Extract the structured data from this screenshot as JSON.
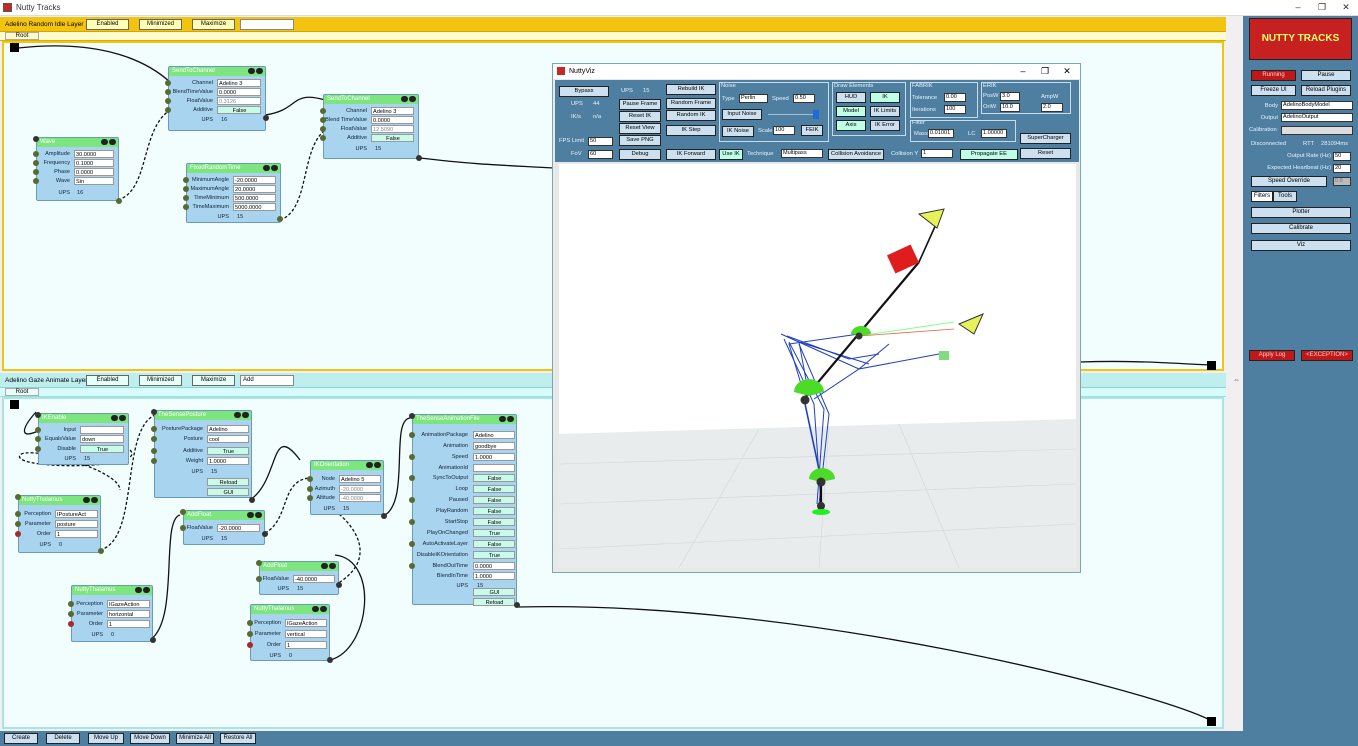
{
  "window": {
    "title": "Nutty Tracks",
    "min": "–",
    "max": "❐",
    "close": "✕"
  },
  "layer1": {
    "name": "Adelino Random Idle Layer",
    "enabled": "Enabled",
    "minimized": "Minimized",
    "maximize": "Maximize",
    "mode": "",
    "root": "Root"
  },
  "layer2": {
    "name": "Adelino Gaze Animate Layer",
    "enabled": "Enabled",
    "minimized": "Minimized",
    "maximize": "Maximize",
    "mode": "Add",
    "root": "Root"
  },
  "nodes": {
    "send1": {
      "title": "SendToChannel",
      "rows": [
        [
          "Channel",
          "Adelino 3"
        ],
        [
          "BlendTimeValue",
          "0.0000"
        ],
        [
          "FloatValue",
          "0.3126"
        ],
        [
          "Additive",
          "False"
        ],
        [
          "UPS",
          "16"
        ]
      ]
    },
    "wave": {
      "title": "Wave",
      "rows": [
        [
          "Amplitude",
          "30.0000"
        ],
        [
          "Frequency",
          "0.1000"
        ],
        [
          "Phase",
          "0.0000"
        ],
        [
          "Wave",
          "Sin"
        ],
        [
          "UPS",
          "16"
        ]
      ]
    },
    "rand": {
      "title": "FixedRandomTime",
      "rows": [
        [
          "MinimumAngle",
          "-20.0000"
        ],
        [
          "MaximumAngle",
          "20.0000"
        ],
        [
          "TimeMinimum",
          "500.0000"
        ],
        [
          "TimeMaximum",
          "5000.0000"
        ],
        [
          "UPS",
          "15"
        ]
      ]
    },
    "send2": {
      "title": "SendToChannel",
      "rows": [
        [
          "Channel",
          "Adelino 3"
        ],
        [
          "Blend TimeValue",
          "0.0000"
        ],
        [
          "FloatValue",
          "12.5090"
        ],
        [
          "Additive",
          "False"
        ],
        [
          "UPS",
          "15"
        ]
      ]
    },
    "ikenable": {
      "title": "IKEnable",
      "rows": [
        [
          "Input",
          ""
        ],
        [
          "EqualsValue",
          "down"
        ],
        [
          "Disable",
          "True"
        ],
        [
          "UPS",
          "15"
        ]
      ]
    },
    "ncr": {
      "title": "NuttyThalamus",
      "rows": [
        [
          "Perception",
          "IPostureAct"
        ],
        [
          "Parameter",
          "posture"
        ],
        [
          "Order",
          "1"
        ],
        [
          "UPS",
          "0"
        ]
      ]
    },
    "posture": {
      "title": "TheSensePosture",
      "rows": [
        [
          "PosturePackage",
          "Adelino"
        ],
        [
          "Posture",
          "cool"
        ],
        [
          "Additive",
          "True"
        ],
        [
          "Weight",
          "1.0000"
        ],
        [
          "UPS",
          "15"
        ],
        [
          "",
          "Reload"
        ],
        [
          "",
          "GUI"
        ]
      ]
    },
    "addf1": {
      "title": "AddFloat",
      "rows": [
        [
          "FloatValue",
          "-20.0000"
        ],
        [
          "UPS",
          "15"
        ]
      ]
    },
    "orient": {
      "title": "IKOrientation",
      "rows": [
        [
          "Node",
          "Adelino 5"
        ],
        [
          "Azimuth",
          "-20.0000"
        ],
        [
          "Altitude",
          "-40.0000"
        ],
        [
          "UPS",
          "15"
        ]
      ]
    },
    "anim": {
      "title": "TheSenseAnimationFile",
      "rows": [
        [
          "AnimationPackage",
          "Adelino"
        ],
        [
          "Animation",
          "goodbye"
        ],
        [
          "Speed",
          "1.0000"
        ],
        [
          "AnimationId",
          ""
        ],
        [
          "SyncToOutput",
          "False"
        ],
        [
          "Loop",
          "False"
        ],
        [
          "Paused",
          "False"
        ],
        [
          "PlayRandom",
          "False"
        ],
        [
          "StartStop",
          "False"
        ],
        [
          "PlayOnChanged",
          "True"
        ],
        [
          "AutoActivateLayer",
          "False"
        ],
        [
          "DisableIKOrientation",
          "True"
        ],
        [
          "BlendOutTime",
          "0.0000"
        ],
        [
          "BlendInTime",
          "1.0000"
        ],
        [
          "UPS",
          "15"
        ],
        [
          "",
          "GUI"
        ],
        [
          "",
          "Reload"
        ]
      ]
    },
    "nt2": {
      "title": "NuttyThalamus",
      "rows": [
        [
          "Perception",
          "IGazeAction"
        ],
        [
          "Parameter",
          "horizontal"
        ],
        [
          "Order",
          "1"
        ],
        [
          "UPS",
          "0"
        ]
      ]
    },
    "addf2": {
      "title": "AddFloat",
      "rows": [
        [
          "FloatValue",
          "-40.0000"
        ],
        [
          "UPS",
          "15"
        ]
      ]
    },
    "nt3": {
      "title": "NuttyThalamus",
      "rows": [
        [
          "Perception",
          "IGazeAction"
        ],
        [
          "Parameter",
          "vertical"
        ],
        [
          "Order",
          "1"
        ],
        [
          "UPS",
          "0"
        ]
      ]
    }
  },
  "viz": {
    "title": "NuttyViz",
    "bypass": "Bypass",
    "ups_label": "UPS",
    "ups_val": "15",
    "ups2_label": "UPS",
    "ups2_val": "44",
    "ik_label": "IK/s",
    "ik_val": "n/a",
    "fps_label": "FPS Limit",
    "fps_val": "50",
    "fov_label": "FoV",
    "fov_val": "60",
    "pause_frame": "Pause Frame",
    "reset_ik": "Reset IK",
    "reset_view": "Reset View",
    "save_png": "Save PNG",
    "debug": "Debug",
    "rebuild_ik": "Rebuild IK",
    "random_frame": "Random Frame",
    "random_ik": "Random IK",
    "ik_step": "IK Step",
    "ik_forward": "IK Forward",
    "noise_label": "Noise",
    "type_label": "Type",
    "type_val": "Perlin",
    "speed_label": "Speed",
    "speed_val": "0.50",
    "input_noise": "Input Noise",
    "ik_noise": "IK Noise",
    "scale_label": "Scale",
    "scale_val": "100",
    "feik": "FEIK",
    "draw_label": "Draw Elements",
    "hud": "HUD",
    "ik": "IK",
    "model": "Model",
    "ik_limits": "IK Limits",
    "axis": "Axis",
    "ik_error": "IK Error",
    "fabrik_label": "FABRIK",
    "tolerance_label": "Tolerance",
    "tolerance_val": "0.00",
    "iterations_label": "Iterations",
    "iterations_val": "100",
    "erik_label": "ERIK",
    "posw_label": "PosW",
    "posw_val": "3.0",
    "oriw_label": "OriW",
    "oriw_val": "10.0",
    "ampw_label": "AmpW",
    "ampw_val": "2.0",
    "filter_label": "Filter",
    "mass_label": "Mass",
    "mass_val": "0.01001",
    "lc_label": "LC",
    "lc_val": "1.00000",
    "supercharger": "SuperCharger",
    "reset": "Reset",
    "use_ik": "Use IK",
    "technique_label": "Technique",
    "technique_val": "Multipass",
    "collision_avoidance": "Collision Avoidance",
    "collision_y_label": "Collision Y",
    "collision_y_val": "1",
    "propagate_ee": "Propagate EE"
  },
  "panel": {
    "logo_text": "NUTTY TRACKS",
    "running": "Running",
    "pause": "Pause",
    "freeze_ui": "Freeze UI",
    "reload_plugins": "Reload Plugins",
    "body_label": "Body",
    "body_val": "AdelinoBodyModel",
    "output_label": "Output",
    "output_val": "AdelinoOutput",
    "calibration_label": "Calibration",
    "disconnected": "Disconnected",
    "rtt": "RTT",
    "rtt_val": "281094ms",
    "output_rate_label": "Output Rate (Hz)",
    "output_rate_val": "50",
    "expected_label": "Expected Heartbeat (Hz)",
    "expected_val": "20",
    "speed_override": "Speed Override",
    "speed_override_val": "0.8",
    "filters": "Filters",
    "tools": "Tools",
    "plotter": "Plotter",
    "calibrate": "Calibrate",
    "viz": "Viz",
    "apply_log": "Apply Log",
    "exception": "<EXCEPTION>"
  },
  "bottom": {
    "create": "Create",
    "delete": "Delete",
    "move_up": "Move Up",
    "move_down": "Move Down",
    "minimize_all": "Minimize All",
    "restore_all": "Restore All"
  }
}
